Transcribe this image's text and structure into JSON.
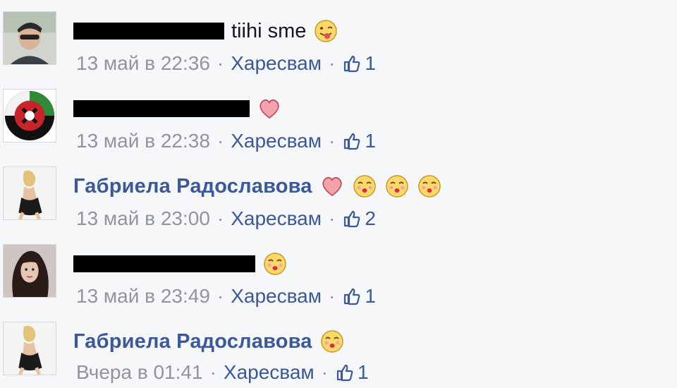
{
  "comments": [
    {
      "author": "",
      "author_redacted": true,
      "text": "tiihi sme",
      "emojis": [
        "tongue-wink-emoji"
      ],
      "time": "13 май в 22:36",
      "like_label": "Харесвам",
      "like_count": "1"
    },
    {
      "author": "",
      "author_redacted": true,
      "text": "",
      "emojis": [
        "heart-emoji"
      ],
      "time": "13 май в 22:38",
      "like_label": "Харесвам",
      "like_count": "1"
    },
    {
      "author": "Габриела Радославова",
      "author_redacted": false,
      "text": "",
      "emojis": [
        "heart-emoji",
        "kiss-emoji",
        "kiss-emoji",
        "kiss-emoji"
      ],
      "time": "13 май в 23:00",
      "like_label": "Харесвам",
      "like_count": "2"
    },
    {
      "author": "",
      "author_redacted": true,
      "text": "",
      "emojis": [
        "kiss-emoji"
      ],
      "time": "13 май в 23:49",
      "like_label": "Харесвам",
      "like_count": "1"
    },
    {
      "author": "Габриела Радославова",
      "author_redacted": false,
      "text": "",
      "emojis": [
        "kiss-emoji"
      ],
      "time": "Вчера в 01:41",
      "like_label": "Харесвам",
      "like_count": "1"
    }
  ],
  "separator": "·",
  "colors": {
    "link": "#3b5998",
    "meta": "#90949c",
    "text": "#141823",
    "background": "#f6f7f9"
  }
}
